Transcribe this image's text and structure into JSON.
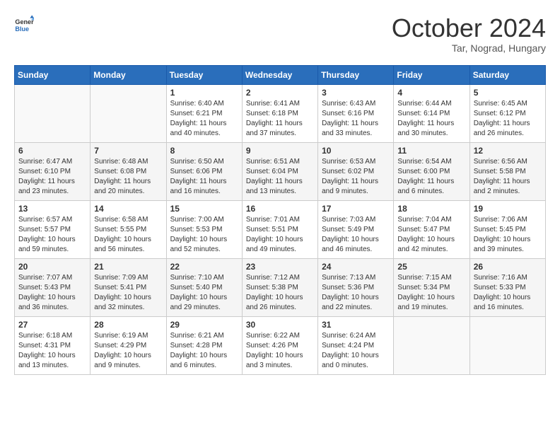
{
  "header": {
    "logo_general": "General",
    "logo_blue": "Blue",
    "month": "October 2024",
    "location": "Tar, Nograd, Hungary"
  },
  "calendar": {
    "weekdays": [
      "Sunday",
      "Monday",
      "Tuesday",
      "Wednesday",
      "Thursday",
      "Friday",
      "Saturday"
    ],
    "rows": [
      [
        {
          "day": "",
          "detail": ""
        },
        {
          "day": "",
          "detail": ""
        },
        {
          "day": "1",
          "detail": "Sunrise: 6:40 AM\nSunset: 6:21 PM\nDaylight: 11 hours and 40 minutes."
        },
        {
          "day": "2",
          "detail": "Sunrise: 6:41 AM\nSunset: 6:18 PM\nDaylight: 11 hours and 37 minutes."
        },
        {
          "day": "3",
          "detail": "Sunrise: 6:43 AM\nSunset: 6:16 PM\nDaylight: 11 hours and 33 minutes."
        },
        {
          "day": "4",
          "detail": "Sunrise: 6:44 AM\nSunset: 6:14 PM\nDaylight: 11 hours and 30 minutes."
        },
        {
          "day": "5",
          "detail": "Sunrise: 6:45 AM\nSunset: 6:12 PM\nDaylight: 11 hours and 26 minutes."
        }
      ],
      [
        {
          "day": "6",
          "detail": "Sunrise: 6:47 AM\nSunset: 6:10 PM\nDaylight: 11 hours and 23 minutes."
        },
        {
          "day": "7",
          "detail": "Sunrise: 6:48 AM\nSunset: 6:08 PM\nDaylight: 11 hours and 20 minutes."
        },
        {
          "day": "8",
          "detail": "Sunrise: 6:50 AM\nSunset: 6:06 PM\nDaylight: 11 hours and 16 minutes."
        },
        {
          "day": "9",
          "detail": "Sunrise: 6:51 AM\nSunset: 6:04 PM\nDaylight: 11 hours and 13 minutes."
        },
        {
          "day": "10",
          "detail": "Sunrise: 6:53 AM\nSunset: 6:02 PM\nDaylight: 11 hours and 9 minutes."
        },
        {
          "day": "11",
          "detail": "Sunrise: 6:54 AM\nSunset: 6:00 PM\nDaylight: 11 hours and 6 minutes."
        },
        {
          "day": "12",
          "detail": "Sunrise: 6:56 AM\nSunset: 5:58 PM\nDaylight: 11 hours and 2 minutes."
        }
      ],
      [
        {
          "day": "13",
          "detail": "Sunrise: 6:57 AM\nSunset: 5:57 PM\nDaylight: 10 hours and 59 minutes."
        },
        {
          "day": "14",
          "detail": "Sunrise: 6:58 AM\nSunset: 5:55 PM\nDaylight: 10 hours and 56 minutes."
        },
        {
          "day": "15",
          "detail": "Sunrise: 7:00 AM\nSunset: 5:53 PM\nDaylight: 10 hours and 52 minutes."
        },
        {
          "day": "16",
          "detail": "Sunrise: 7:01 AM\nSunset: 5:51 PM\nDaylight: 10 hours and 49 minutes."
        },
        {
          "day": "17",
          "detail": "Sunrise: 7:03 AM\nSunset: 5:49 PM\nDaylight: 10 hours and 46 minutes."
        },
        {
          "day": "18",
          "detail": "Sunrise: 7:04 AM\nSunset: 5:47 PM\nDaylight: 10 hours and 42 minutes."
        },
        {
          "day": "19",
          "detail": "Sunrise: 7:06 AM\nSunset: 5:45 PM\nDaylight: 10 hours and 39 minutes."
        }
      ],
      [
        {
          "day": "20",
          "detail": "Sunrise: 7:07 AM\nSunset: 5:43 PM\nDaylight: 10 hours and 36 minutes."
        },
        {
          "day": "21",
          "detail": "Sunrise: 7:09 AM\nSunset: 5:41 PM\nDaylight: 10 hours and 32 minutes."
        },
        {
          "day": "22",
          "detail": "Sunrise: 7:10 AM\nSunset: 5:40 PM\nDaylight: 10 hours and 29 minutes."
        },
        {
          "day": "23",
          "detail": "Sunrise: 7:12 AM\nSunset: 5:38 PM\nDaylight: 10 hours and 26 minutes."
        },
        {
          "day": "24",
          "detail": "Sunrise: 7:13 AM\nSunset: 5:36 PM\nDaylight: 10 hours and 22 minutes."
        },
        {
          "day": "25",
          "detail": "Sunrise: 7:15 AM\nSunset: 5:34 PM\nDaylight: 10 hours and 19 minutes."
        },
        {
          "day": "26",
          "detail": "Sunrise: 7:16 AM\nSunset: 5:33 PM\nDaylight: 10 hours and 16 minutes."
        }
      ],
      [
        {
          "day": "27",
          "detail": "Sunrise: 6:18 AM\nSunset: 4:31 PM\nDaylight: 10 hours and 13 minutes."
        },
        {
          "day": "28",
          "detail": "Sunrise: 6:19 AM\nSunset: 4:29 PM\nDaylight: 10 hours and 9 minutes."
        },
        {
          "day": "29",
          "detail": "Sunrise: 6:21 AM\nSunset: 4:28 PM\nDaylight: 10 hours and 6 minutes."
        },
        {
          "day": "30",
          "detail": "Sunrise: 6:22 AM\nSunset: 4:26 PM\nDaylight: 10 hours and 3 minutes."
        },
        {
          "day": "31",
          "detail": "Sunrise: 6:24 AM\nSunset: 4:24 PM\nDaylight: 10 hours and 0 minutes."
        },
        {
          "day": "",
          "detail": ""
        },
        {
          "day": "",
          "detail": ""
        }
      ]
    ]
  }
}
